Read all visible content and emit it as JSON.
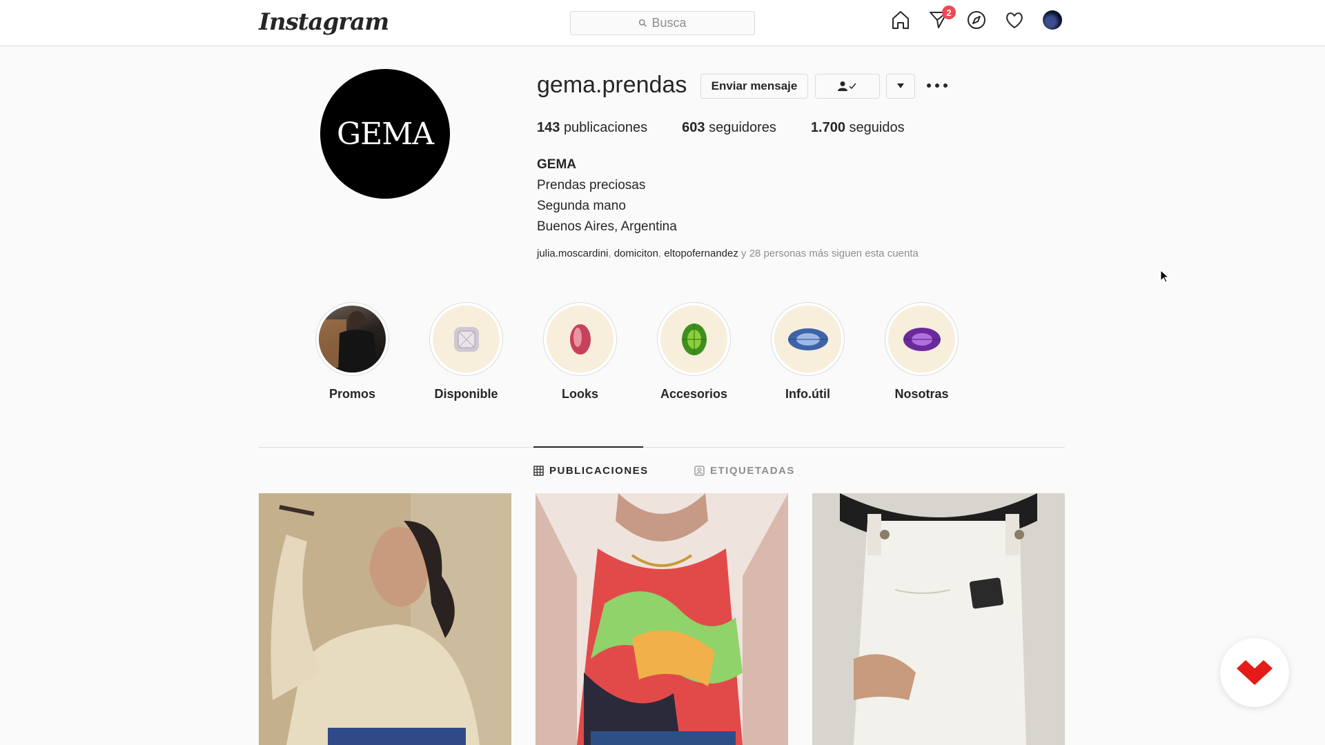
{
  "nav": {
    "logo": "Instagram",
    "search_placeholder": "Busca",
    "direct_badge": "2"
  },
  "profile": {
    "username": "gema.prendas",
    "avatar_text": "GEMA",
    "message_button": "Enviar mensaje",
    "stats": [
      {
        "count": "143",
        "label": "publicaciones"
      },
      {
        "count": "603",
        "label": "seguidores"
      },
      {
        "count": "1.700",
        "label": "seguidos"
      }
    ],
    "bio": {
      "name": "GEMA",
      "lines": [
        "Prendas preciosas",
        "Segunda mano",
        "Buenos Aires, Argentina"
      ]
    },
    "followed_by": {
      "names": [
        "julia.moscardini",
        "domiciton",
        "eltopofernandez"
      ],
      "suffix": "y 28 personas más siguen esta cuenta"
    }
  },
  "highlights": [
    {
      "label": "Promos",
      "icon": "promo-photo"
    },
    {
      "label": "Disponible",
      "icon": "diamond-gem-icon"
    },
    {
      "label": "Looks",
      "icon": "pink-gem-icon"
    },
    {
      "label": "Accesorios",
      "icon": "green-gem-icon"
    },
    {
      "label": "Info.útil",
      "icon": "blue-gem-icon"
    },
    {
      "label": "Nosotras",
      "icon": "purple-gem-icon"
    }
  ],
  "tabs": {
    "posts": "PUBLICACIONES",
    "tagged": "ETIQUETADAS",
    "active": "posts"
  },
  "colors": {
    "accent_text": "#262626",
    "muted_text": "#8e8e8e",
    "border": "#dbdbdb",
    "badge_red": "#ed4956",
    "floating_logo_red": "#e41b17"
  }
}
